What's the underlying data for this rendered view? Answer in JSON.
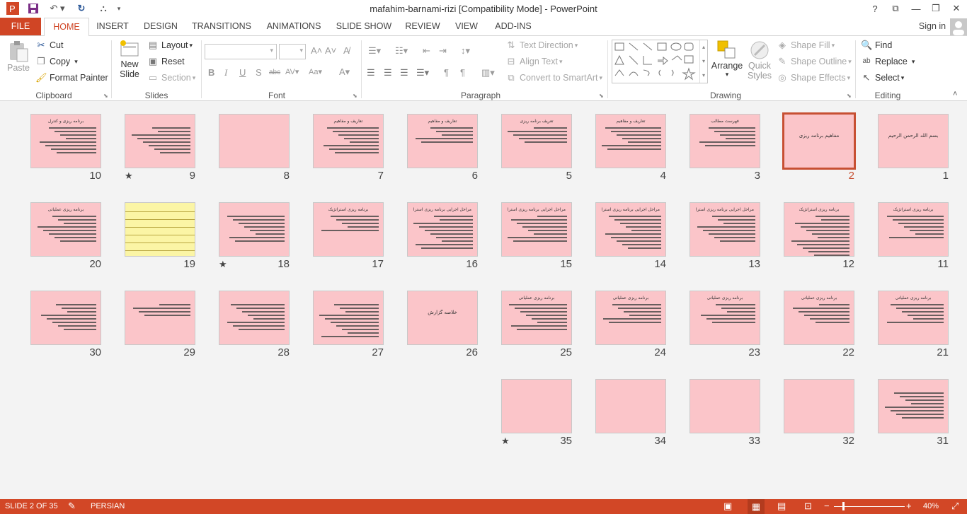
{
  "window": {
    "title": "mafahim-barnami-rizi [Compatibility Mode] - PowerPoint",
    "help": "?",
    "sign_in": "Sign in"
  },
  "tabs": [
    "FILE",
    "HOME",
    "INSERT",
    "DESIGN",
    "TRANSITIONS",
    "ANIMATIONS",
    "SLIDE SHOW",
    "REVIEW",
    "VIEW",
    "ADD-INS"
  ],
  "ribbon": {
    "clipboard": {
      "label": "Clipboard",
      "paste": "Paste",
      "cut": "Cut",
      "copy": "Copy",
      "format_painter": "Format Painter"
    },
    "slides": {
      "label": "Slides",
      "new_slide_1": "New",
      "new_slide_2": "Slide",
      "layout": "Layout",
      "reset": "Reset",
      "section": "Section"
    },
    "font": {
      "label": "Font",
      "font_name": "",
      "font_size": ""
    },
    "paragraph": {
      "label": "Paragraph",
      "text_direction": "Text Direction",
      "align_text": "Align Text",
      "smartart": "Convert to SmartArt"
    },
    "drawing": {
      "label": "Drawing",
      "arrange": "Arrange",
      "quick_styles_1": "Quick",
      "quick_styles_2": "Styles",
      "shape_fill": "Shape Fill",
      "shape_outline": "Shape Outline",
      "shape_effects": "Shape Effects"
    },
    "editing": {
      "label": "Editing",
      "find": "Find",
      "replace": "Replace",
      "select": "Select"
    }
  },
  "slides": [
    {
      "n": "1",
      "title": "بسم الله الرحمن الرحیم",
      "lines": 0
    },
    {
      "n": "2",
      "title": "مفاهیم برنامه ریزی",
      "lines": 0,
      "selected": true
    },
    {
      "n": "3",
      "title": "فهرست مطالب",
      "lines": 6
    },
    {
      "n": "4",
      "title": "تعاریف و مفاهیم",
      "lines": 7
    },
    {
      "n": "5",
      "title": "تعریف برنامه ریزی",
      "lines": 5
    },
    {
      "n": "6",
      "title": "تعاریف و مفاهیم",
      "lines": 5
    },
    {
      "n": "7",
      "title": "تعاریف و مفاهیم",
      "lines": 8
    },
    {
      "n": "8",
      "title": "",
      "lines": 0
    },
    {
      "n": "9",
      "title": "",
      "lines": 8,
      "star": true
    },
    {
      "n": "10",
      "title": "برنامه ریزی و کنترل",
      "lines": 8
    },
    {
      "n": "11",
      "title": "برنامه ریزی استراتژیک",
      "lines": 7
    },
    {
      "n": "12",
      "title": "برنامه ریزی استراتژیک",
      "lines": 12
    },
    {
      "n": "13",
      "title": "مراحل اجرایی برنامه ریزی استراتژیک",
      "lines": 8
    },
    {
      "n": "14",
      "title": "مراحل اجرایی برنامه ریزی استراتژیک",
      "lines": 10
    },
    {
      "n": "15",
      "title": "مراحل اجرایی برنامه ریزی استراتژیک",
      "lines": 8
    },
    {
      "n": "16",
      "title": "مراحل اجرایی برنامه ریزی استراتژیک",
      "lines": 10
    },
    {
      "n": "17",
      "title": "برنامه ریزی استراتژیک",
      "lines": 5
    },
    {
      "n": "18",
      "title": "",
      "lines": 8,
      "star": true
    },
    {
      "n": "19",
      "title": "",
      "lines": 0,
      "yellow": true
    },
    {
      "n": "20",
      "title": "برنامه ریزی عملیاتی",
      "lines": 8
    },
    {
      "n": "21",
      "title": "برنامه ریزی عملیاتی",
      "lines": 6
    },
    {
      "n": "22",
      "title": "برنامه ریزی عملیاتی",
      "lines": 6
    },
    {
      "n": "23",
      "title": "برنامه ریزی عملیاتی",
      "lines": 6
    },
    {
      "n": "24",
      "title": "برنامه ریزی عملیاتی",
      "lines": 6
    },
    {
      "n": "25",
      "title": "برنامه ریزی عملیاتی",
      "lines": 8
    },
    {
      "n": "26",
      "title": "خلاصه گزارش",
      "lines": 0
    },
    {
      "n": "27",
      "title": "",
      "lines": 10
    },
    {
      "n": "28",
      "title": "",
      "lines": 8
    },
    {
      "n": "29",
      "title": "",
      "lines": 4
    },
    {
      "n": "30",
      "title": "",
      "lines": 8
    },
    {
      "n": "31",
      "title": "",
      "lines": 8
    },
    {
      "n": "32",
      "title": "",
      "lines": 0
    },
    {
      "n": "33",
      "title": "",
      "lines": 0
    },
    {
      "n": "34",
      "title": "",
      "lines": 0
    },
    {
      "n": "35",
      "title": "",
      "lines": 0,
      "star": true
    }
  ],
  "status": {
    "slide": "SLIDE 2 OF 35",
    "language": "PERSIAN",
    "zoom": "40%"
  }
}
